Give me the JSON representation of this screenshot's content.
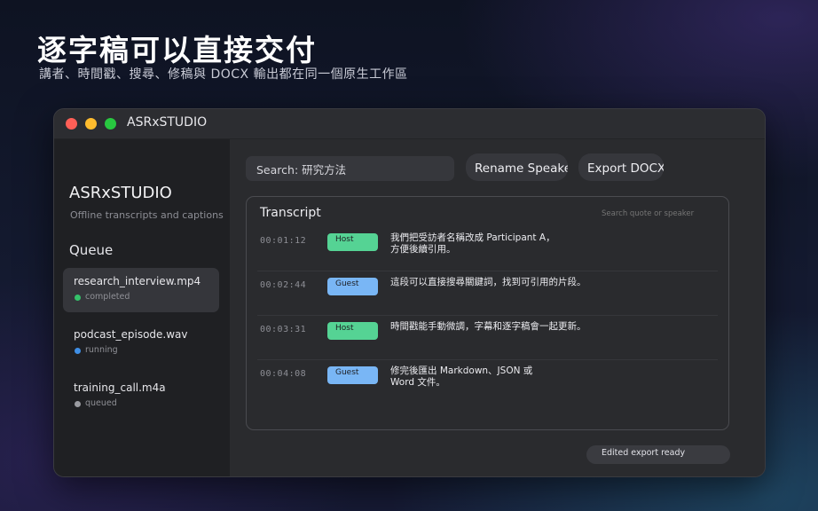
{
  "hero": {
    "title": "逐字稿可以直接交付",
    "subtitle": "講者、時間戳、搜尋、修稿與 DOCX 輸出都在同一個原生工作區"
  },
  "window": {
    "title": "ASRxSTUDIO",
    "traffic_colors": {
      "close": "#ff5f57",
      "minimize": "#febc2e",
      "maximize": "#28c840"
    }
  },
  "sidebar": {
    "brand": "ASRxSTUDIO",
    "brand_subtitle": "Offline transcripts and captions",
    "queue_heading": "Queue",
    "items": [
      {
        "name": "research_interview.mp4",
        "status": "completed",
        "dot_color": "#35c26a"
      },
      {
        "name": "podcast_episode.wav",
        "status": "running",
        "dot_color": "#3f8fe6"
      },
      {
        "name": "training_call.m4a",
        "status": "queued",
        "dot_color": "#9a9ba1"
      }
    ]
  },
  "toolbar": {
    "search_value": "Search: 研究方法",
    "rename_label": "Rename Speaker",
    "export_label": "Export DOCX"
  },
  "transcript": {
    "title": "Transcript",
    "search_placeholder": "Search quote or speaker",
    "rows": [
      {
        "time": "00:01:12",
        "speaker": "Host",
        "text": "我們把受訪者名稱改成 Participant A，方便後續引用。"
      },
      {
        "time": "00:02:44",
        "speaker": "Guest",
        "text": "這段可以直接搜尋關鍵詞，找到可引用的片段。"
      },
      {
        "time": "00:03:31",
        "speaker": "Host",
        "text": "時間戳能手動微調，字幕和逐字稿會一起更新。"
      },
      {
        "time": "00:04:08",
        "speaker": "Guest",
        "text": "修完後匯出 Markdown、JSON 或 Word 文件。"
      }
    ],
    "speaker_colors": {
      "Host": "#55d394",
      "Guest": "#79b6f5"
    }
  },
  "status": {
    "label": "Edited export ready"
  }
}
